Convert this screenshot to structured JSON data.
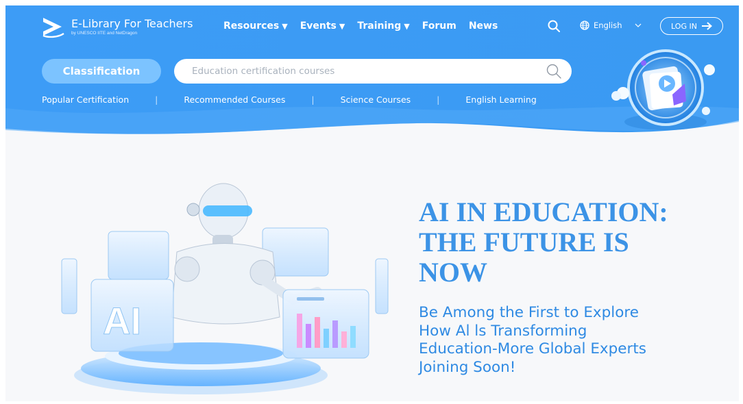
{
  "brand": {
    "title": "E-Library For Teachers",
    "subtitle": "by UNESCO IITE and NetDragon"
  },
  "nav": {
    "items": [
      {
        "label": "Resources",
        "dropdown": true
      },
      {
        "label": "Events",
        "dropdown": true
      },
      {
        "label": "Training",
        "dropdown": true
      },
      {
        "label": "Forum",
        "dropdown": false
      },
      {
        "label": "News",
        "dropdown": false
      }
    ],
    "dropdown_glyph": "▼",
    "language": "English",
    "login_label": "LOG IN"
  },
  "search": {
    "classification_label": "Classification",
    "placeholder": "Education certification courses"
  },
  "quick_links": [
    "Popular Certification",
    "Recommended Courses",
    "Science Courses",
    "English Learning"
  ],
  "banner": {
    "headline_lines": [
      "AI IN EDUCATION:",
      "THE FUTURE IS",
      "NOW"
    ],
    "subhead_lines": [
      "Be Among the First to Explore",
      "How Al ls Transforming",
      "Education-More Global Experts",
      "Joining Soon!"
    ],
    "art_badge": "AI"
  },
  "colors": {
    "header_blue": "#3c9cf4",
    "accent_blue": "#3c93e6",
    "classification_bg": "#7cc3ff"
  },
  "icons": [
    "logo-mark-icon",
    "search-icon",
    "globe-icon",
    "chevron-down-icon",
    "arrow-right-icon"
  ]
}
